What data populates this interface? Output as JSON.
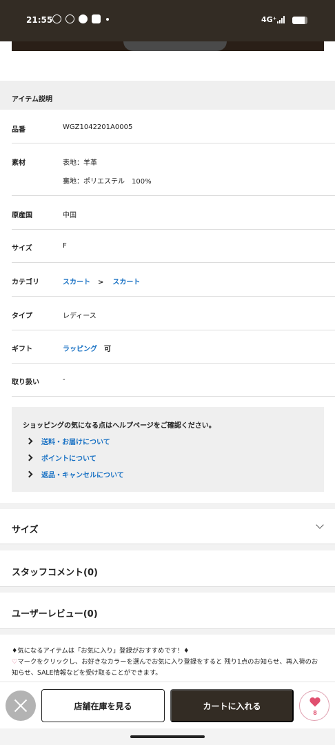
{
  "status_bar": {
    "time": "21:55",
    "network": "4G⁺",
    "battery_level": 0.8
  },
  "item_description": {
    "header": "アイテム説明",
    "rows": {
      "product_number": {
        "label": "品番",
        "value": "WGZ1042201A0005"
      },
      "material": {
        "label": "素材",
        "value_line1": "表地：羊革",
        "value_line2": "裏地：ポリエステル　100%"
      },
      "origin": {
        "label": "原産国",
        "value": "中国"
      },
      "size": {
        "label": "サイズ",
        "value": "F"
      },
      "category": {
        "label": "カテゴリ",
        "link1": "スカート",
        "separator": ">",
        "link2": "スカート"
      },
      "type": {
        "label": "タイプ",
        "value": "レディース"
      },
      "gift": {
        "label": "ギフト",
        "link": "ラッピング",
        "suffix": "可"
      },
      "handling": {
        "label": "取り扱い",
        "value": "-"
      }
    }
  },
  "help": {
    "text": "ショッピングの気になる点はヘルプページをご確認ください。",
    "links": [
      "送料・お届けについて",
      "ポイントについて",
      "返品・キャンセルについて"
    ]
  },
  "accordions": {
    "size": "サイズ",
    "staff_comment": "スタッフコメント(0)",
    "user_review": "ユーザーレビュー(0)"
  },
  "notice": {
    "line1": "♦気になるアイテムは「お気に入り」登録がおすすめです！♦",
    "heart": "♡",
    "line2": "マークをクリックし、お好きなカラーを選んでお気に入り登録をすると 残り1点のお知らせ、再入荷のお知らせ、SALE情報などを受け取ることができます。"
  },
  "bottom_bar": {
    "store_stock_label": "店舗在庫を見る",
    "add_to_cart_label": "カートに入れる",
    "favorite_count": "8"
  },
  "icons": {
    "close": "close-icon",
    "heart": "heart-icon",
    "chevron_right": "chevron-right-icon",
    "chevron_down": "chevron-down-icon"
  },
  "colors": {
    "brand_dark": "#332c24",
    "link": "#1a72c4",
    "favorite": "#e0506f"
  }
}
